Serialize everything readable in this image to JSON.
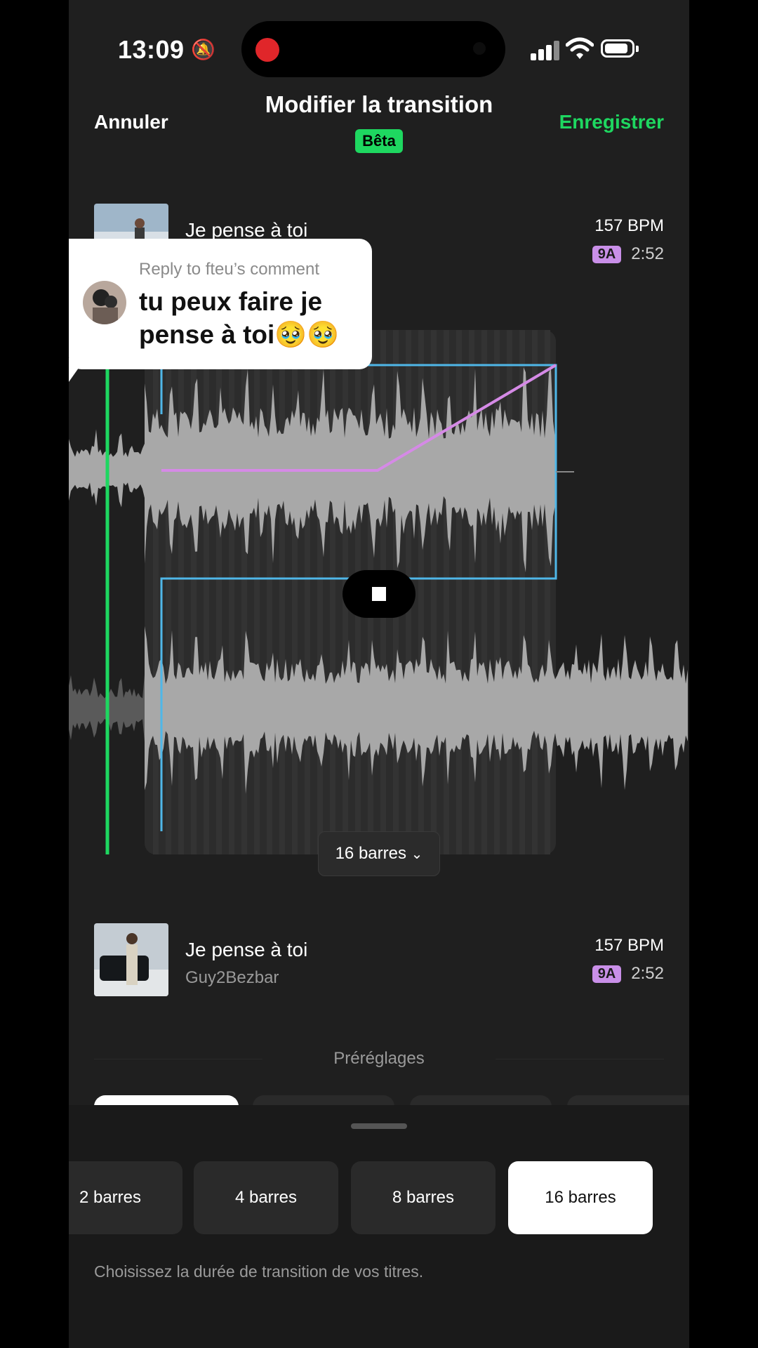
{
  "status_bar": {
    "time": "13:09"
  },
  "header": {
    "cancel": "Annuler",
    "title": "Modifier la transition",
    "beta": "Bêta",
    "save": "Enregistrer"
  },
  "track_top": {
    "title": "Je pense à toi",
    "bpm": "157 BPM",
    "key": "9A",
    "duration": "2:52"
  },
  "comment": {
    "reply_to": "Reply to fteu’s comment",
    "text": "tu peux faire je pense à toi🥹🥹"
  },
  "transition": {
    "length_label": "16 barres"
  },
  "track_bottom": {
    "title": "Je pense à toi",
    "artist": "Guy2Bezbar",
    "bpm": "157 BPM",
    "key": "9A",
    "duration": "2:52"
  },
  "presets": {
    "label": "Préréglages"
  },
  "sheet": {
    "options": [
      "2 barres",
      "4 barres",
      "8 barres",
      "16 barres"
    ],
    "selected": "16 barres",
    "hint": "Choisissez la durée de transition de vos titres."
  },
  "colors": {
    "accent": "#1ed760",
    "key_badge": "#c98fe8",
    "fade_line": "#d58ae6",
    "region_outline": "#4fb7e8"
  }
}
